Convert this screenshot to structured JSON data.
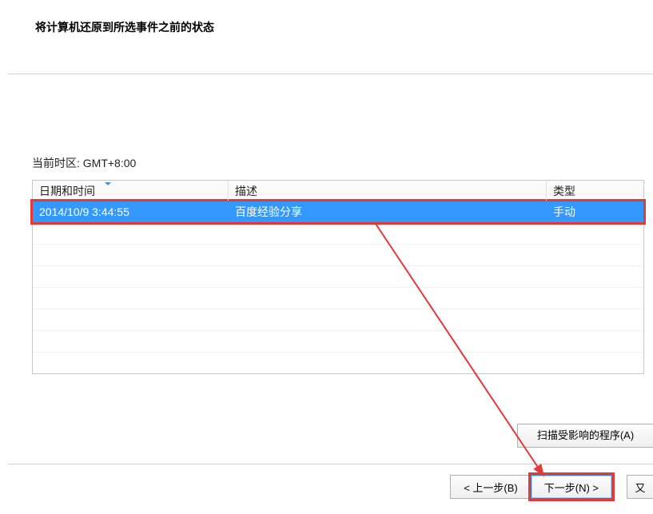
{
  "page_title": "将计算机还原到所选事件之前的状态",
  "timezone_label": "当前时区: GMT+8:00",
  "table": {
    "headers": {
      "datetime": "日期和时间",
      "description": "描述",
      "type": "类型"
    },
    "rows": [
      {
        "datetime": "2014/10/9 3:44:55",
        "description": "百度经验分享",
        "type": "手动"
      }
    ]
  },
  "buttons": {
    "scan_affected": "扫描受影响的程序(A)",
    "back": "< 上一步(B)",
    "next": "下一步(N) >",
    "cancel_fragment": "又"
  }
}
